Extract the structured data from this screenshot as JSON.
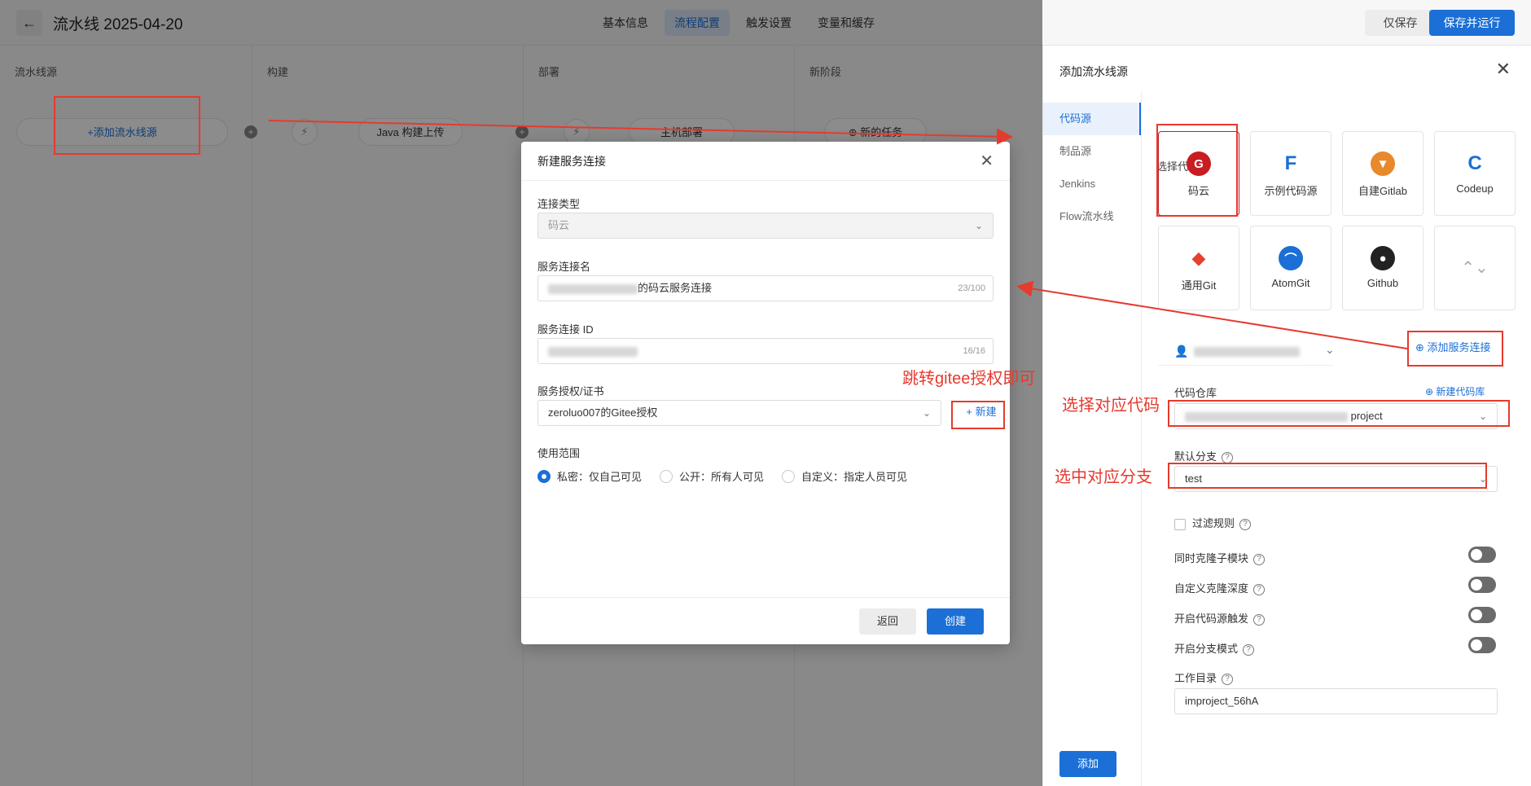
{
  "topbar": {
    "back_icon": "back-arrow-icon",
    "title": "流水线 2025-04-20",
    "tabs": [
      {
        "label": "基本信息",
        "active": false
      },
      {
        "label": "流程配置",
        "active": true
      },
      {
        "label": "触发设置",
        "active": false
      },
      {
        "label": "变量和缓存",
        "active": false
      }
    ],
    "save_only": "仅保存",
    "save_and_run": "保存并运行"
  },
  "canvas": {
    "stages": [
      "流水线源",
      "构建",
      "部署",
      "新阶段"
    ],
    "add_source": "+添加流水线源",
    "java_task": "Java 构建上传",
    "deploy_task": "主机部署",
    "new_task": "新的任务"
  },
  "modal": {
    "title": "新建服务连接",
    "conn_type_label": "连接类型",
    "conn_type_value": "码云",
    "conn_name_label": "服务连接名",
    "conn_name_suffix": "的码云服务连接",
    "conn_name_count": "23/100",
    "conn_id_label": "服务连接 ID",
    "conn_id_count": "16/16",
    "auth_label": "服务授权/证书",
    "auth_value": "zeroluo007的Gitee授权",
    "new_label": "新建",
    "scope_label": "使用范围",
    "scope_options": [
      {
        "label": "私密：仅自己可见",
        "checked": true
      },
      {
        "label": "公开：所有人可见",
        "checked": false
      },
      {
        "label": "自定义：指定人员可见",
        "checked": false
      }
    ],
    "back_btn": "返回",
    "create_btn": "创建"
  },
  "panel": {
    "title": "添加流水线源",
    "nav": [
      {
        "label": "代码源",
        "active": true
      },
      {
        "label": "制品源",
        "active": false
      },
      {
        "label": "Jenkins",
        "active": false
      },
      {
        "label": "Flow流水线",
        "active": false
      }
    ],
    "select_label": "选择代码源",
    "sources": [
      {
        "name": "码云",
        "icon": "gitee-icon",
        "color": "#c71d23",
        "glyph": "G"
      },
      {
        "name": "示例代码源",
        "icon": "sample-source-icon",
        "color": "#1b6fd6",
        "glyph": "F"
      },
      {
        "name": "自建Gitlab",
        "icon": "gitlab-icon",
        "color": "#e8892b",
        "glyph": "🦊"
      },
      {
        "name": "Codeup",
        "icon": "codeup-icon",
        "color": "#1b6fd6",
        "glyph": "C"
      },
      {
        "name": "通用Git",
        "icon": "git-icon",
        "color": "#e5412d",
        "glyph": "◆"
      },
      {
        "name": "AtomGit",
        "icon": "atomgit-icon",
        "color": "#1b6fd6",
        "glyph": "⌒"
      },
      {
        "name": "Github",
        "icon": "github-icon",
        "color": "#222222",
        "glyph": "●"
      }
    ],
    "add_conn": "添加服务连接",
    "repo_label": "代码仓库",
    "new_repo": "新建代码库",
    "repo_value_suffix": "project",
    "branch_label": "默认分支",
    "branch_value": "test",
    "filter_rule": "过滤规则",
    "toggles": [
      "同时克隆子模块",
      "自定义克隆深度",
      "开启代码源触发",
      "开启分支模式"
    ],
    "workdir_label": "工作目录",
    "workdir_value": "improject_56hA",
    "add_btn": "添加"
  },
  "annotations": {
    "gitee_auth": "跳转gitee授权即可",
    "choose_repo": "选择对应代码",
    "choose_branch": "选中对应分支"
  },
  "colors": {
    "primary": "#1b6fd6",
    "annotation": "#e63a2e"
  }
}
